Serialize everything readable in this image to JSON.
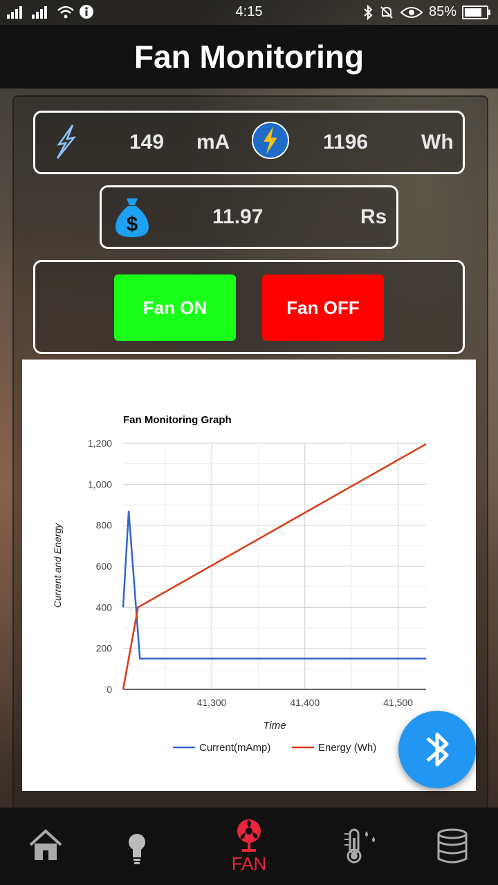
{
  "status_bar": {
    "time": "4:15",
    "battery": "85%",
    "battery_level": 0.85
  },
  "header": {
    "title": "Fan Monitoring"
  },
  "readings": {
    "current_value": "149",
    "current_unit": "mA",
    "energy_value": "1196",
    "energy_unit": "Wh",
    "cost_value": "11.97",
    "cost_unit": "Rs"
  },
  "controls": {
    "fan_on_label": "Fan ON",
    "fan_off_label": "Fan OFF",
    "on_color": "#19ff19",
    "off_color": "#ff0000"
  },
  "chart_data": {
    "type": "line",
    "title": "Fan Monitoring Graph",
    "xlabel": "Time",
    "ylabel": "Current and Energy",
    "xlim": [
      41205,
      41530
    ],
    "ylim": [
      0,
      1200
    ],
    "xticks": [
      "41,300",
      "41,400",
      "41,500"
    ],
    "yticks": [
      "1,200",
      "1,000",
      "800",
      "600",
      "400",
      "200",
      "0"
    ],
    "grid": true,
    "legend_position": "bottom",
    "series": [
      {
        "name": "Current(mAmp)",
        "color": "#3366cc",
        "x": [
          41205,
          41211,
          41223,
          41530
        ],
        "y": [
          400,
          870,
          150,
          150
        ]
      },
      {
        "name": "Energy (Wh)",
        "color": "#dc3912",
        "x": [
          41205,
          41221,
          41530
        ],
        "y": [
          0,
          400,
          1196
        ]
      }
    ]
  },
  "nav": {
    "active_label": "FAN",
    "active_color": "#e8253a"
  }
}
